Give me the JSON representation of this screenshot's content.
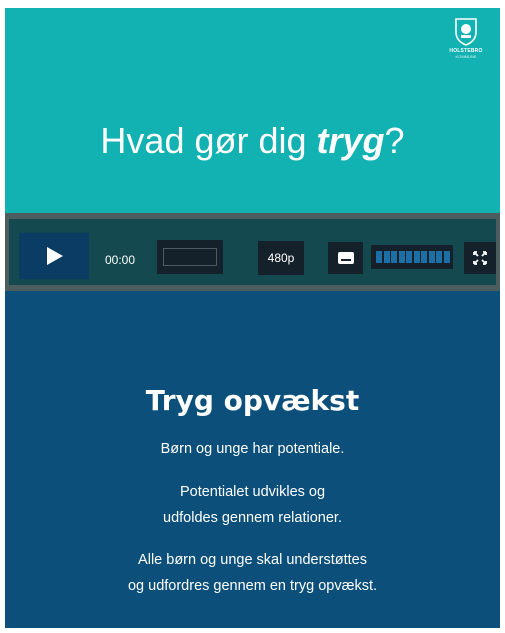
{
  "video": {
    "logo_name": "HOLSTEBRO",
    "logo_sub": "KOMMUNE",
    "headline_prefix": "Hvad gør dig ",
    "headline_emphasis": "tryg",
    "headline_suffix": "?"
  },
  "controls": {
    "time": "00:00",
    "quality": "480p",
    "volume_level": 1.0,
    "icons": [
      "play-icon",
      "captions-icon",
      "fullscreen-icon"
    ]
  },
  "content": {
    "title": "Tryg opvækst",
    "line1": "Børn og unge har potentiale.",
    "line2a": "Potentialet udvikles og",
    "line2b": "udfoldes gennem relationer.",
    "line3a": "Alle børn og unge skal understøttes",
    "line3b": "og udfordres gennem en tryg opvækst."
  },
  "colors": {
    "video_bg": "#12b2b2",
    "controls_bg": "#13494f",
    "content_bg": "#0b4f7a",
    "play_button": "#0b3c63",
    "volume_fill": "#1c6fa5"
  }
}
